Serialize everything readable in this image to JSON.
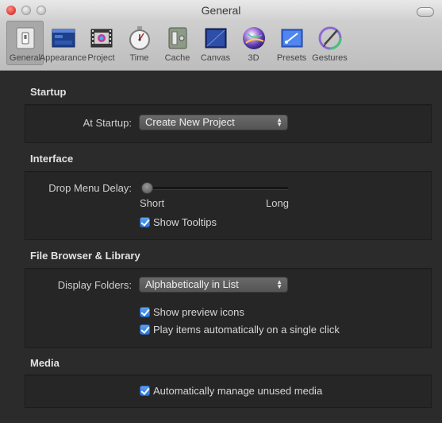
{
  "window": {
    "title": "General"
  },
  "toolbar": {
    "items": [
      {
        "label": "General",
        "icon": "general-switch-icon"
      },
      {
        "label": "Appearance",
        "icon": "appearance-window-icon"
      },
      {
        "label": "Project",
        "icon": "project-film-icon"
      },
      {
        "label": "Time",
        "icon": "stopwatch-icon"
      },
      {
        "label": "Cache",
        "icon": "cache-safe-icon"
      },
      {
        "label": "Canvas",
        "icon": "canvas-icon"
      },
      {
        "label": "3D",
        "icon": "sphere-3d-icon"
      },
      {
        "label": "Presets",
        "icon": "presets-icon"
      },
      {
        "label": "Gestures",
        "icon": "gestures-pen-icon"
      }
    ]
  },
  "startup": {
    "title": "Startup",
    "at_startup_label": "At Startup:",
    "at_startup_value": "Create New Project"
  },
  "interface": {
    "title": "Interface",
    "drop_menu_delay_label": "Drop Menu Delay:",
    "slider_min_label": "Short",
    "slider_max_label": "Long",
    "slider_value": 0,
    "show_tooltips_label": "Show Tooltips",
    "show_tooltips_checked": true
  },
  "file_browser": {
    "title": "File Browser & Library",
    "display_folders_label": "Display Folders:",
    "display_folders_value": "Alphabetically in List",
    "show_preview_label": "Show preview icons",
    "show_preview_checked": true,
    "play_items_label": "Play items automatically on a single click",
    "play_items_checked": true
  },
  "media": {
    "title": "Media",
    "manage_unused_label": "Automatically manage unused media",
    "manage_unused_checked": true
  },
  "colors": {
    "background": "#2b2b2b",
    "panel": "#262626",
    "checkbox_blue": "#2f74d6",
    "close_red": "#e0443e"
  }
}
